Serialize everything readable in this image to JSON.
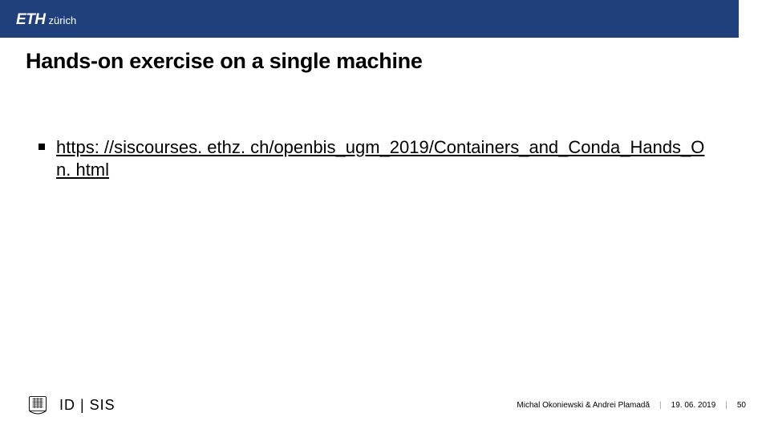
{
  "header": {
    "logo_eth": "ETH",
    "logo_zurich": "zürich"
  },
  "title": "Hands-on exercise on a single machine",
  "content": {
    "bullet_link": "https: //siscourses. ethz. ch/openbis_ugm_2019/Containers_and_Conda_Hands_On. html"
  },
  "footer": {
    "unit": "ID | SIS",
    "authors": "Michal Okoniewski & Andrei Plamadă",
    "date": "19. 06. 2019",
    "page": "50"
  }
}
